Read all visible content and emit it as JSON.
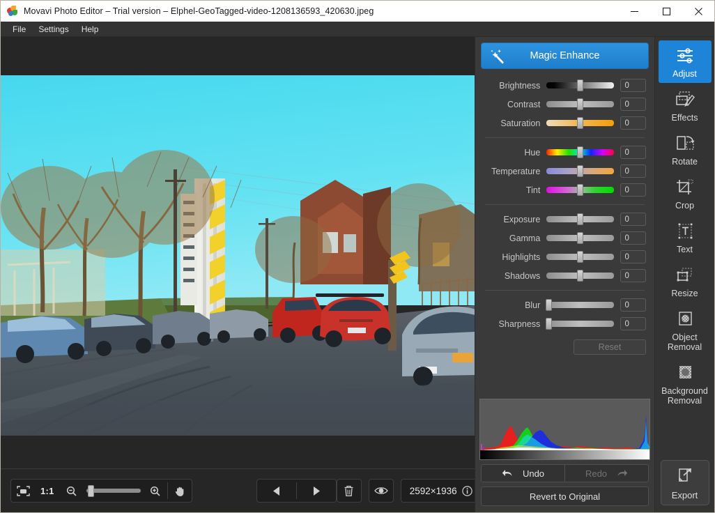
{
  "window": {
    "title": "Movavi Photo Editor – Trial version – Elphel-GeoTagged-video-1208136593_420630.jpeg",
    "app_icon": "movavi-logo-icon",
    "minimize_label": "minimize-icon",
    "maximize_label": "maximize-icon",
    "close_label": "close-icon"
  },
  "menubar": {
    "items": [
      {
        "label": "File"
      },
      {
        "label": "Settings"
      },
      {
        "label": "Help"
      }
    ]
  },
  "canvas": {
    "photo_alt": "Street scene with bare autumn trees, cyan sky, parked cars along a sloping road, red sedan and red pickup truck, stop signs, yellow chevron sign and a white and yellow striped high-rise building"
  },
  "bottom_toolbar": {
    "fit_icon": "fit-to-screen-icon",
    "ratio_label": "1:1",
    "zoom_out_icon": "zoom-out-icon",
    "zoom_in_icon": "zoom-in-icon",
    "zoom_slider_value": 8,
    "hand_icon": "hand-pan-icon",
    "prev_icon": "previous-image-icon",
    "next_icon": "next-image-icon",
    "delete_icon": "trash-icon",
    "compare_icon": "eye-compare-icon",
    "dimensions": "2592×1936",
    "info_icon": "info-icon"
  },
  "adjust_panel": {
    "magic_enhance": {
      "label": "Magic Enhance",
      "icon": "magic-wand-icon"
    },
    "sliders": [
      {
        "name": "Brightness",
        "value": "0",
        "track": "t-bright",
        "pos": 50
      },
      {
        "name": "Contrast",
        "value": "0",
        "track": "t-flat",
        "pos": 50
      },
      {
        "name": "Saturation",
        "value": "0",
        "track": "t-sat",
        "pos": 50
      },
      {
        "name": "Hue",
        "value": "0",
        "track": "t-hue",
        "pos": 50
      },
      {
        "name": "Temperature",
        "value": "0",
        "track": "t-temp",
        "pos": 50
      },
      {
        "name": "Tint",
        "value": "0",
        "track": "t-tint",
        "pos": 50
      },
      {
        "name": "Exposure",
        "value": "0",
        "track": "t-flat",
        "pos": 50
      },
      {
        "name": "Gamma",
        "value": "0",
        "track": "t-flat",
        "pos": 50
      },
      {
        "name": "Highlights",
        "value": "0",
        "track": "t-flat",
        "pos": 50
      },
      {
        "name": "Shadows",
        "value": "0",
        "track": "t-flat",
        "pos": 50
      },
      {
        "name": "Blur",
        "value": "0",
        "track": "t-flat",
        "pos": 0
      },
      {
        "name": "Sharpness",
        "value": "0",
        "track": "t-flat",
        "pos": 0
      }
    ],
    "reset_label": "Reset",
    "undo_label": "Undo",
    "redo_label": "Redo",
    "undo_icon": "undo-arrow-icon",
    "redo_icon": "redo-arrow-icon",
    "revert_label": "Revert to Original",
    "histogram_alt": "RGB histogram with black to white tone strip"
  },
  "tool_rail": {
    "tools": [
      {
        "label": "Adjust",
        "icon": "sliders-icon",
        "active": true
      },
      {
        "label": "Effects",
        "icon": "effects-brush-icon",
        "active": false
      },
      {
        "label": "Rotate",
        "icon": "rotate-icon",
        "active": false
      },
      {
        "label": "Crop",
        "icon": "crop-icon",
        "active": false
      },
      {
        "label": "Text",
        "icon": "text-icon",
        "active": false
      },
      {
        "label": "Resize",
        "icon": "resize-icon",
        "active": false
      },
      {
        "label": "Object\nRemoval",
        "icon": "object-removal-icon",
        "active": false
      },
      {
        "label": "Background\nRemoval",
        "icon": "background-removal-icon",
        "active": false
      }
    ],
    "export": {
      "label": "Export",
      "icon": "export-icon"
    }
  },
  "colors": {
    "accent_blue": "#1e84d8",
    "panel_bg": "#3a3a3a",
    "rail_bg": "#333333",
    "canvas_bg": "#262626",
    "titlebar_bg": "#ffffff"
  }
}
